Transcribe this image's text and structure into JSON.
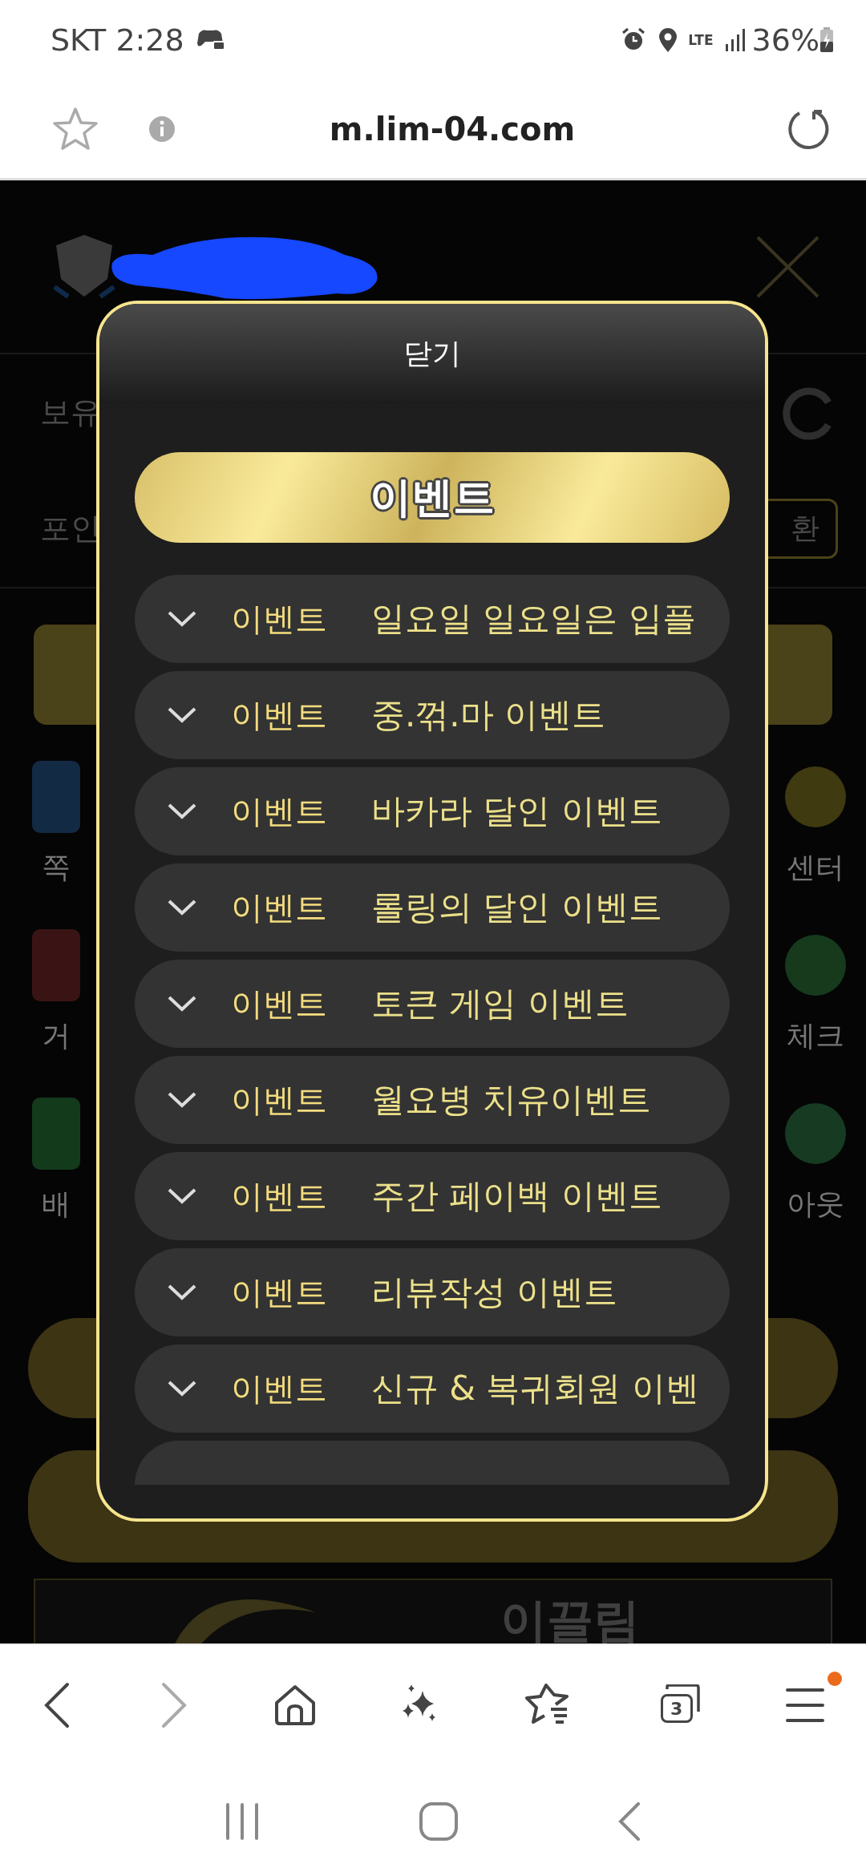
{
  "status_bar": {
    "carrier_time": "SKT 2:28",
    "network": "LTE",
    "battery": "36%"
  },
  "address_bar": {
    "url": "m.lim-04.com"
  },
  "page": {
    "balance_labels": [
      "보유",
      "포인"
    ],
    "exchange_button": "환",
    "side_labels": [
      {
        "left": "쪽",
        "right": "센터"
      },
      {
        "left": "거",
        "right": "체크"
      },
      {
        "left": "배",
        "right": "아웃"
      }
    ],
    "banner_text": "이끌림"
  },
  "modal": {
    "close": "닫기",
    "heading": "이벤트",
    "items": [
      {
        "category": "이벤트",
        "title": "일요일 일요일은 입플",
        "expanded": false
      },
      {
        "category": "이벤트",
        "title": "중.꺾.마 이벤트",
        "expanded": false
      },
      {
        "category": "이벤트",
        "title": "바카라 달인 이벤트",
        "expanded": false
      },
      {
        "category": "이벤트",
        "title": "롤링의 달인 이벤트",
        "expanded": false
      },
      {
        "category": "이벤트",
        "title": "토큰 게임 이벤트",
        "expanded": false
      },
      {
        "category": "이벤트",
        "title": "월요병 치유이벤트",
        "expanded": false
      },
      {
        "category": "이벤트",
        "title": "주간 페이백 이벤트",
        "expanded": false
      },
      {
        "category": "이벤트",
        "title": "리뷰작성 이벤트",
        "expanded": false
      },
      {
        "category": "이벤트",
        "title": "신규 & 복귀회원 이벤",
        "expanded": false
      }
    ]
  },
  "browser_toolbar": {
    "tab_count": "3",
    "menu_badge": true
  }
}
